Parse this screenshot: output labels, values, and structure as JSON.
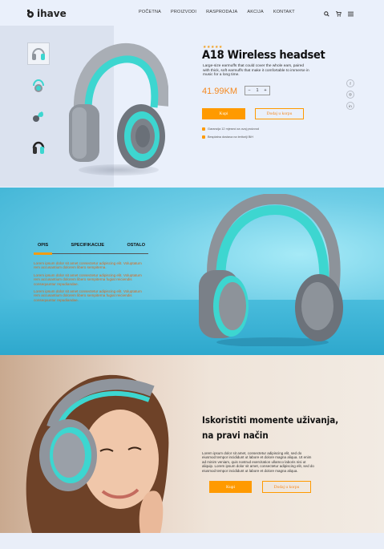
{
  "brand": {
    "logo_text": "ihave",
    "accent": "#ff9a00",
    "teal": "#3dd6d0"
  },
  "nav": {
    "items": [
      "POČETNA",
      "PROIZVODI",
      "RASPRODAJA",
      "AKCIJA",
      "KONTAKT"
    ]
  },
  "header_icons": [
    "search-icon",
    "cart-icon",
    "menu-icon"
  ],
  "product": {
    "rating_stars": "★★★★★",
    "title": "A18 Wireless headset",
    "description": "Large-size earmuffs that could cover the whole ears, paired with thick, soft earmuffs that make it comfortable to immerse in music for a long time.",
    "price": "41.99KM",
    "qty_minus": "−",
    "qty_value": "1",
    "qty_plus": "+",
    "buy_label": "Kupi",
    "add_cart_label": "Dodaj u korpu",
    "notes": [
      "Garancija 12 mjeseci za ovaj proizvod",
      "Besplatna dostava na teritoriji BiH"
    ],
    "social": [
      "f",
      "◎",
      "in"
    ],
    "thumbnails": [
      "front-view",
      "side-view",
      "folded-view",
      "dark-view"
    ]
  },
  "details": {
    "tabs": [
      "OPIS",
      "SPECIFIKACIJE",
      "OSTALO"
    ],
    "active_tab": "OPIS",
    "paragraphs": [
      "Lorem ipsum dolor sit amet consectetur adipiscing elit. Voluptatum rem accusantium dolorem libero sempiterna.",
      "Lorem ipsum dolor sit amet consectetur adipiscing elit. Voluptatum rem accusantium dolorem libero sempiterna fugiat reiciendis consequuntur repudiandae.",
      "Lorem ipsum dolor sit amet consectetur adipiscing elit. Voluptatum rem accusantium dolorem libero sempiterna fugiat reiciendis consequuntur repudiandae."
    ]
  },
  "lifestyle": {
    "title_line1": "Iskoristiti momente uživanja,",
    "title_line2": "na pravi način",
    "text": "Lorem ipsum dolor sit amet, consectetur adipiscing elit, sed do eiusmod tempor incididunt ut labore et dolore magna aliqua. Ut enim ad minim veniam, quis nostrud exercitation ullamco laboris nisi ut aliquip. Lorem ipsum dolor sit amet, consectetur adipiscing elit, sed do eiusmod tempor incididunt ut labore et dolore magna aliqua.",
    "buy_label": "Kupi",
    "add_cart_label": "Dodaj u korpu"
  }
}
